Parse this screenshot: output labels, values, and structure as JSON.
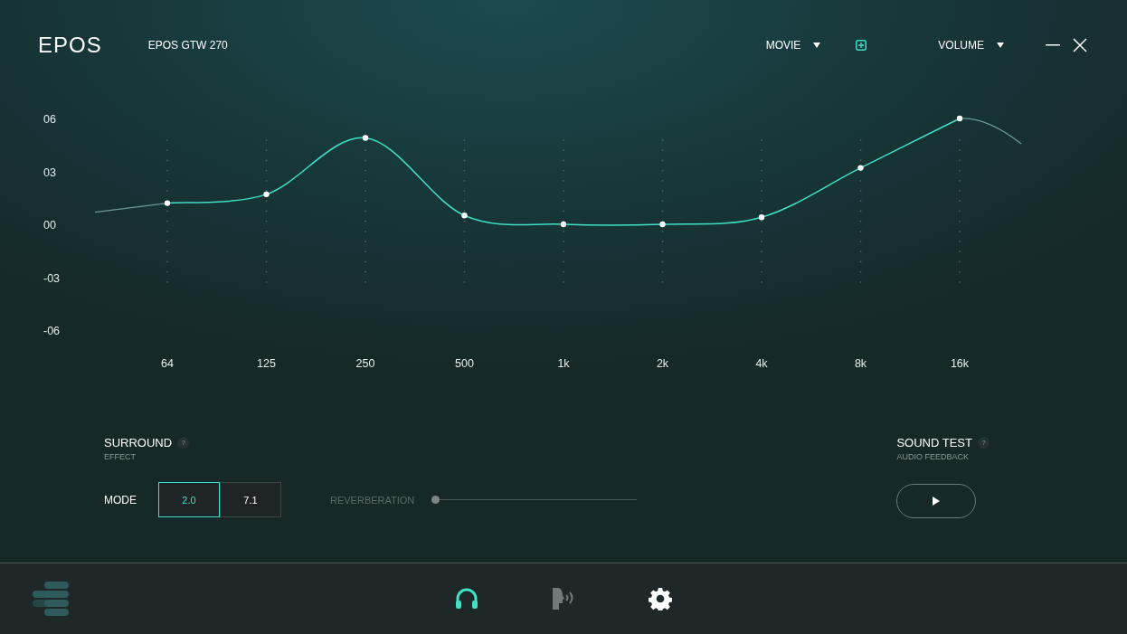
{
  "header": {
    "brand": "EPOS",
    "device": "EPOS GTW 270",
    "preset": "MOVIE",
    "mode_menu": "VOLUME"
  },
  "equalizer": {
    "chart_data": {
      "type": "line",
      "categories": [
        "64",
        "125",
        "250",
        "500",
        "1k",
        "2k",
        "4k",
        "8k",
        "16k"
      ],
      "series": [
        {
          "color": "#3fe0c5",
          "marker": true,
          "values": [
            1.2,
            1.7,
            4.9,
            0.5,
            0,
            0,
            0.4,
            3.2,
            6
          ]
        }
      ],
      "ylim": [
        -6,
        6
      ],
      "yticks": [
        {
          "value": 6,
          "label": "06"
        },
        {
          "value": 3,
          "label": "03"
        },
        {
          "value": 0,
          "label": "00"
        },
        {
          "value": -3,
          "label": "-03"
        },
        {
          "value": -6,
          "label": "-06"
        }
      ]
    }
  },
  "surround": {
    "title": "SURROUND",
    "help": "?",
    "subtitle": "EFFECT",
    "mode_label": "MODE",
    "modes": [
      {
        "label": "2.0",
        "selected": true
      },
      {
        "label": "7.1",
        "selected": false
      }
    ],
    "reverberation": {
      "label": "REVERBERATION",
      "level": 0,
      "disabled": true
    }
  },
  "sound_test": {
    "title": "SOUND TEST",
    "help": "?",
    "subtitle": "AUDIO FEEDBACK"
  },
  "nav": [
    {
      "kind": "headphones",
      "selected": true,
      "disabled": false
    },
    {
      "kind": "voice",
      "selected": false,
      "disabled": true
    },
    {
      "kind": "settings",
      "selected": false,
      "disabled": false
    }
  ]
}
